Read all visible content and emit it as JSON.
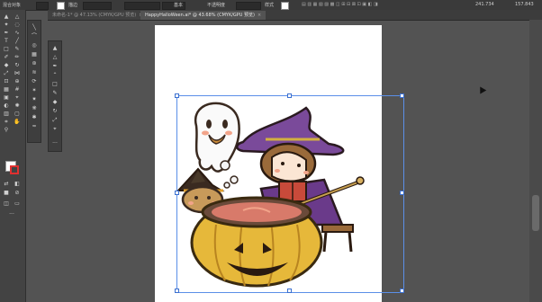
{
  "control_bar": {
    "selection_label": "混合对象",
    "stroke_label": "描边",
    "opacity_label": "不透明度",
    "style_label": "样式",
    "basic_label": "基本",
    "x_value": "241.734",
    "y_value": "157.843"
  },
  "tabs": [
    {
      "label": "未命名-1* @ 47.13% (CMYK/GPU 预览)",
      "active": false,
      "close": "×"
    },
    {
      "label": "HappyHalloWeen.ai* @ 43.68% (CMYK/GPU 预览)",
      "active": true,
      "close": "×"
    }
  ],
  "tools": {
    "main": [
      "selection-tool",
      "direct-selection-tool",
      "magic-wand-tool",
      "lasso-tool",
      "pen-tool",
      "curvature-tool",
      "type-tool",
      "line-tool",
      "rectangle-tool",
      "paintbrush-tool",
      "shaper-tool",
      "pencil-tool",
      "eraser-tool",
      "rotate-tool",
      "scale-tool",
      "width-tool",
      "free-transform-tool",
      "shape-builder-tool",
      "perspective-grid-tool",
      "mesh-tool",
      "gradient-tool",
      "eyedropper-tool",
      "blend-tool",
      "symbol-sprayer-tool",
      "column-graph-tool",
      "artboard-tool",
      "slice-tool",
      "hand-tool",
      "zoom-tool"
    ],
    "more_label": "···"
  },
  "colors": {
    "fill": "#ffffff",
    "stroke": "#e03030",
    "selection": "#5b8fe8",
    "canvas_bg": "#535353"
  }
}
